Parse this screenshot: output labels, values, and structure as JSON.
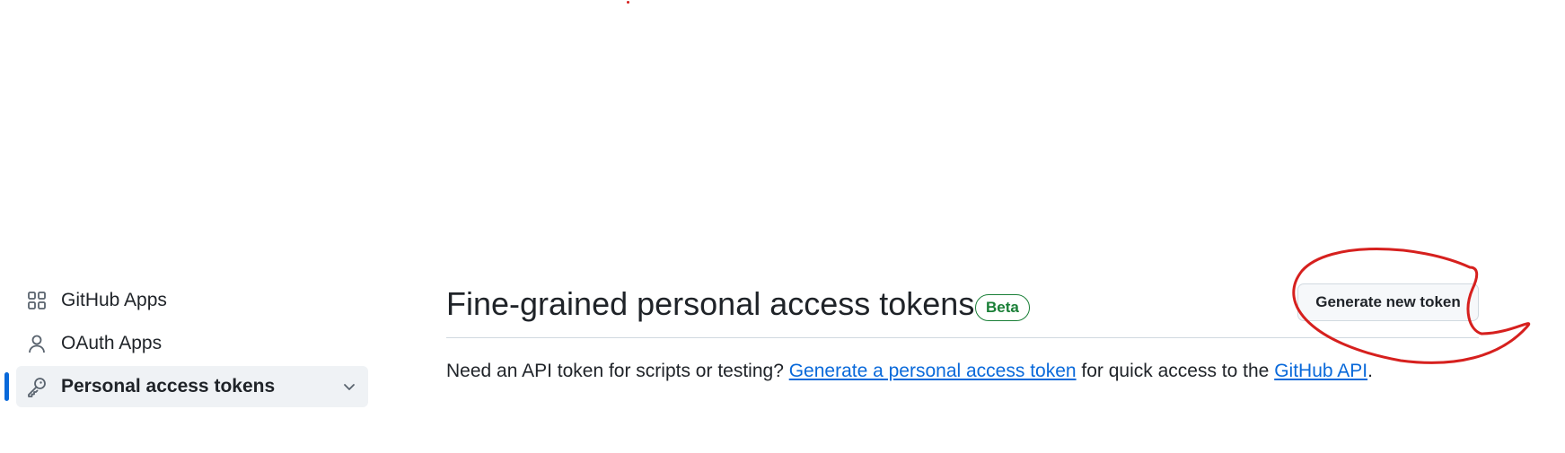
{
  "sidebar": {
    "items": [
      {
        "label": "GitHub Apps",
        "icon": "apps-grid-icon",
        "active": false
      },
      {
        "label": "OAuth Apps",
        "icon": "person-icon",
        "active": false
      },
      {
        "label": "Personal access tokens",
        "icon": "key-icon",
        "active": true,
        "expandable": true
      }
    ]
  },
  "main": {
    "title": "Fine-grained personal access tokens",
    "badge": "Beta",
    "generate_button": "Generate new token",
    "description": {
      "before": "Need an API token for scripts or testing? ",
      "link1": "Generate a personal access token",
      "middle": " for quick access to the ",
      "link2": "GitHub API",
      "after": "."
    }
  },
  "colors": {
    "accent": "#0969da",
    "badge_green": "#1a7f37",
    "annotation_red": "#d6201e",
    "active_bg": "#eff2f5"
  }
}
